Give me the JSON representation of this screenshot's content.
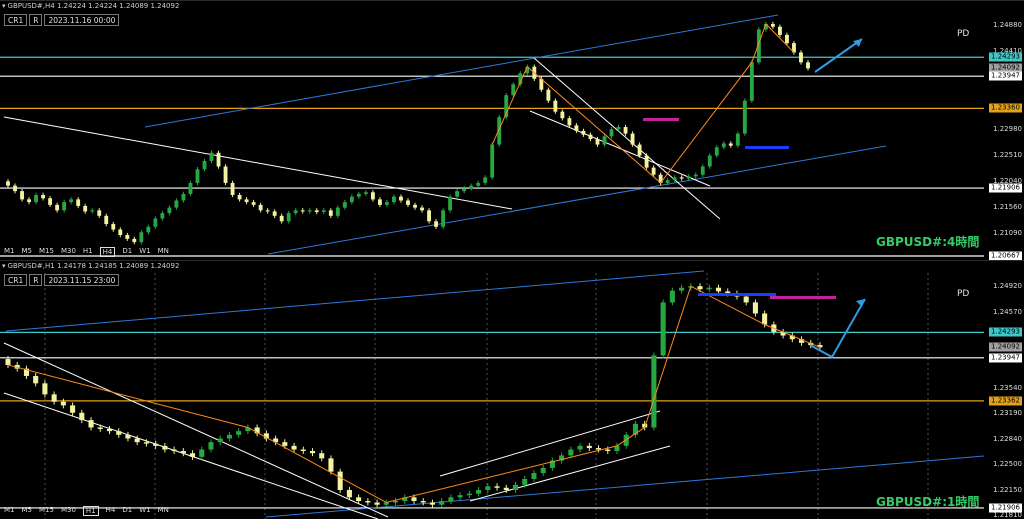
{
  "colors": {
    "bull": "#27a843",
    "bear": "#f2f2a0",
    "white_line": "#ffffff",
    "cyan_line": "#3fc8c8",
    "orange_line": "#e3a21a",
    "channel_blue": "#2e78d8",
    "magenta": "#c0239a",
    "blue_bar": "#1a3cff",
    "arrow": "#2f9be0",
    "label_green": "#33cc66",
    "zigzag": "#ff8a1a"
  },
  "h4": {
    "header": "GBPUSD#,H4  1.24224 1.24224 1.24089 1.24092",
    "datetime": "2023.11.16 00:00",
    "cr": "CR1",
    "r": "R",
    "pd": "PD",
    "watermark": "GBPUSD#:4時間",
    "timeframes": [
      "M1",
      "M5",
      "M15",
      "M30",
      "H1",
      "H4",
      "D1",
      "W1",
      "MN"
    ],
    "active_tf": "H4"
  },
  "h1": {
    "header": "GBPUSD#,H1  1.24178 1.24185 1.24089 1.24092",
    "datetime": "2023.11.15 23:00",
    "cr": "CR1",
    "r": "R",
    "pd": "PD",
    "watermark": "GBPUSD#:1時間",
    "timeframes": [
      "M1",
      "M5",
      "M15",
      "M30",
      "H1",
      "H4",
      "D1",
      "W1",
      "MN"
    ],
    "active_tf": "H1"
  },
  "chart_data": [
    {
      "type": "candlestick",
      "title": "GBPUSD#,H4",
      "ohlc": {
        "open": 1.24224,
        "high": 1.24224,
        "low": 1.24089,
        "close": 1.24092
      },
      "ylim": [
        1.20667,
        1.251
      ],
      "y_ticks": [
        1.2488,
        1.2441,
        1.2336,
        1.2298,
        1.2251,
        1.2204,
        1.2156,
        1.2109
      ],
      "levels": [
        {
          "price": 1.24293,
          "color": "cyan",
          "label": "1.24293"
        },
        {
          "price": 1.24092,
          "color": "gray",
          "label": "1.24092"
        },
        {
          "price": 1.23947,
          "color": "white",
          "label": "1.23947"
        },
        {
          "price": 1.2336,
          "color": "orange",
          "label": "1.23360"
        },
        {
          "price": 1.21906,
          "color": "white",
          "label": "1.21906"
        },
        {
          "price": 1.20667,
          "color": "white",
          "label": "1.20667"
        }
      ],
      "closes": [
        1.2195,
        1.2185,
        1.217,
        1.2165,
        1.2178,
        1.2172,
        1.216,
        1.215,
        1.2165,
        1.217,
        1.2158,
        1.2148,
        1.215,
        1.214,
        1.2125,
        1.2115,
        1.2105,
        1.2098,
        1.2092,
        1.211,
        1.212,
        1.2135,
        1.2145,
        1.2155,
        1.2168,
        1.218,
        1.22,
        1.2225,
        1.224,
        1.2255,
        1.223,
        1.22,
        1.2178,
        1.217,
        1.2165,
        1.216,
        1.215,
        1.2148,
        1.214,
        1.213,
        1.2145,
        1.215,
        1.2148,
        1.215,
        1.2147,
        1.215,
        1.214,
        1.2155,
        1.2165,
        1.2175,
        1.218,
        1.2183,
        1.217,
        1.216,
        1.2165,
        1.2175,
        1.2168,
        1.216,
        1.2155,
        1.215,
        1.213,
        1.212,
        1.215,
        1.2175,
        1.2185,
        1.219,
        1.2195,
        1.22,
        1.221,
        1.227,
        1.232,
        1.236,
        1.238,
        1.24,
        1.2412,
        1.239,
        1.237,
        1.235,
        1.233,
        1.2318,
        1.2305,
        1.2295,
        1.2288,
        1.228,
        1.227,
        1.2285,
        1.2298,
        1.2302,
        1.229,
        1.227,
        1.225,
        1.2228,
        1.2215,
        1.22,
        1.2205,
        1.221,
        1.2208,
        1.2212,
        1.2215,
        1.223,
        1.225,
        1.2265,
        1.2272,
        1.2268,
        1.229,
        1.235,
        1.242,
        1.248,
        1.249,
        1.2485,
        1.247,
        1.2455,
        1.2438,
        1.242,
        1.2409
      ]
    },
    {
      "type": "candlestick",
      "title": "GBPUSD#,H1",
      "ohlc": {
        "open": 1.24178,
        "high": 1.24185,
        "low": 1.24089,
        "close": 1.24092
      },
      "ylim": [
        1.2181,
        1.251
      ],
      "y_ticks": [
        1.2492,
        1.2457,
        1.2354,
        1.2319,
        1.2284,
        1.225,
        1.2215,
        1.2181
      ],
      "levels": [
        {
          "price": 1.24293,
          "color": "cyan",
          "label": "1.24293"
        },
        {
          "price": 1.24092,
          "color": "gray",
          "label": "1.24092"
        },
        {
          "price": 1.23947,
          "color": "white",
          "label": "1.23947"
        },
        {
          "price": 1.23362,
          "color": "orange",
          "label": "1.23362"
        },
        {
          "price": 1.21906,
          "color": "white",
          "label": "1.21906"
        }
      ],
      "closes": [
        1.2385,
        1.238,
        1.237,
        1.236,
        1.2345,
        1.2335,
        1.233,
        1.232,
        1.231,
        1.23,
        1.2298,
        1.2295,
        1.229,
        1.2285,
        1.228,
        1.2278,
        1.2275,
        1.227,
        1.2268,
        1.2265,
        1.226,
        1.227,
        1.228,
        1.2285,
        1.229,
        1.2295,
        1.23,
        1.2292,
        1.2285,
        1.228,
        1.2275,
        1.227,
        1.2268,
        1.2265,
        1.2258,
        1.224,
        1.2215,
        1.2205,
        1.22,
        1.2198,
        1.2195,
        1.2198,
        1.22,
        1.2205,
        1.22,
        1.2198,
        1.2195,
        1.22,
        1.2205,
        1.2208,
        1.221,
        1.2215,
        1.222,
        1.2218,
        1.2215,
        1.2222,
        1.223,
        1.2238,
        1.2245,
        1.2255,
        1.2262,
        1.227,
        1.2275,
        1.2272,
        1.227,
        1.2268,
        1.2275,
        1.229,
        1.2305,
        1.23,
        1.2398,
        1.247,
        1.2486,
        1.249,
        1.2492,
        1.2488,
        1.249,
        1.2485,
        1.2482,
        1.2478,
        1.247,
        1.2455,
        1.244,
        1.243,
        1.2425,
        1.242,
        1.2415,
        1.2412,
        1.2409
      ]
    }
  ]
}
